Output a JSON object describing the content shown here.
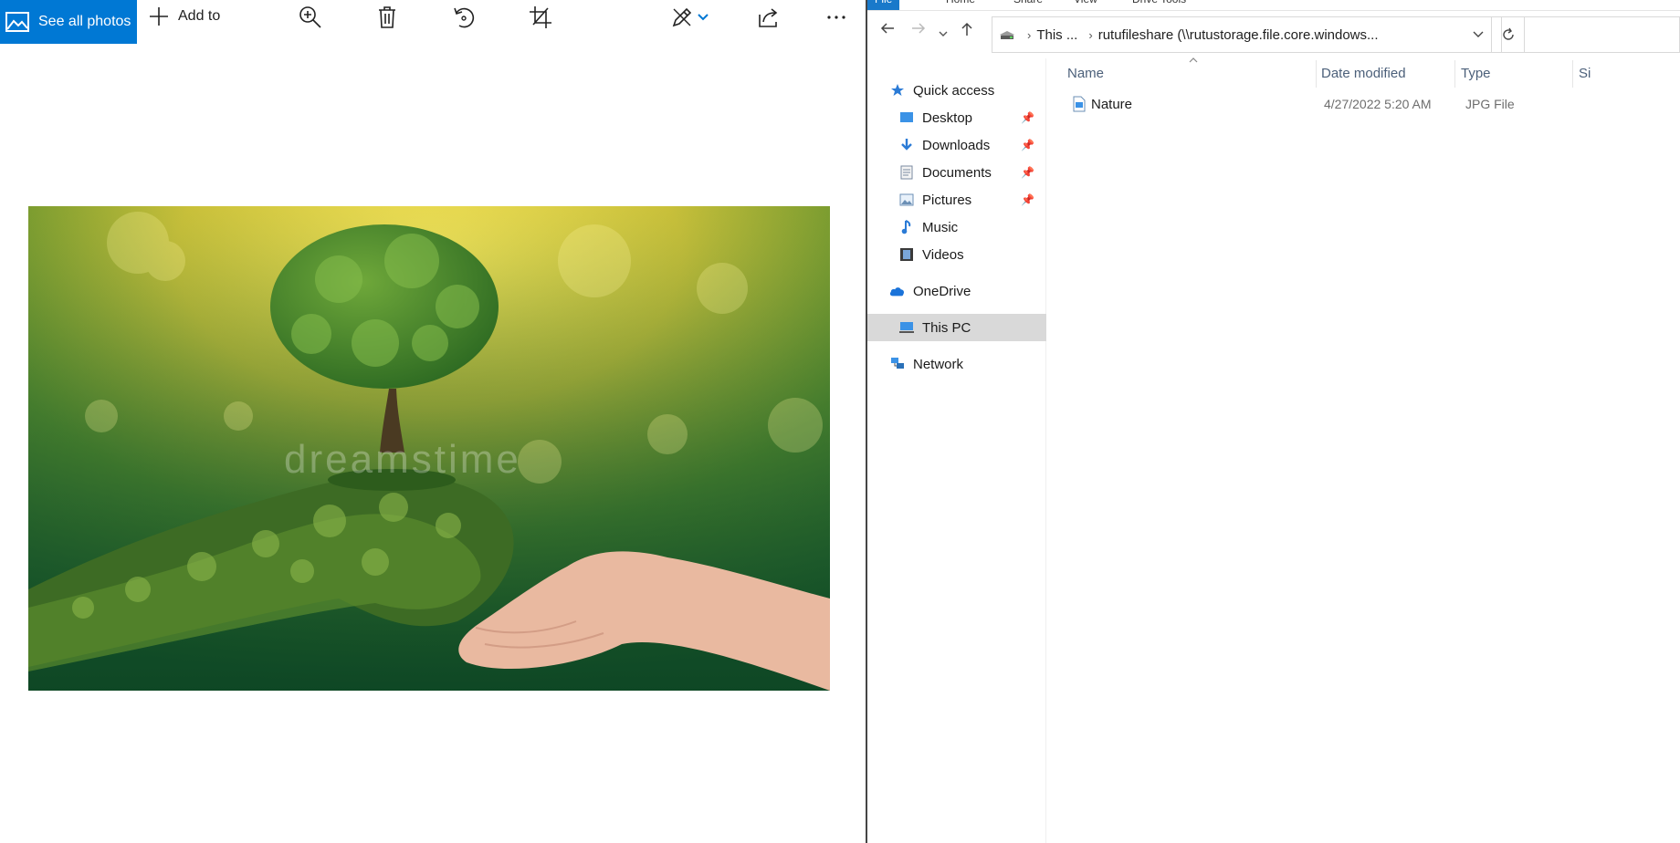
{
  "photos": {
    "see_all_label": "See all photos",
    "add_to_label": "Add to",
    "toolbar_icons": [
      "zoom-in-icon",
      "delete-icon",
      "rotate-icon",
      "crop-icon",
      "edit-icon",
      "share-icon",
      "more-icon"
    ],
    "image_subject": "tree-in-hands-nature-photo",
    "watermark": "dreamstime"
  },
  "explorer": {
    "ribbon_tabs": [
      "File",
      "Home",
      "Share",
      "View",
      "Drive Tools"
    ],
    "address": {
      "crumb1": "This ...",
      "crumb2": "rutufileshare (\\\\rutustorage.file.core.windows..."
    },
    "nav": {
      "quick_access": "Quick access",
      "desktop": "Desktop",
      "downloads": "Downloads",
      "documents": "Documents",
      "pictures": "Pictures",
      "music": "Music",
      "videos": "Videos",
      "onedrive": "OneDrive",
      "this_pc": "This PC",
      "network": "Network"
    },
    "columns": {
      "name": "Name",
      "date": "Date modified",
      "type": "Type",
      "size": "Si"
    },
    "files": [
      {
        "name": "Nature",
        "date": "4/27/2022 5:20 AM",
        "type": "JPG File"
      }
    ]
  },
  "colors": {
    "accent": "#0078d4",
    "header_text": "#4c607a",
    "selected_bg": "#d9d9d9"
  }
}
